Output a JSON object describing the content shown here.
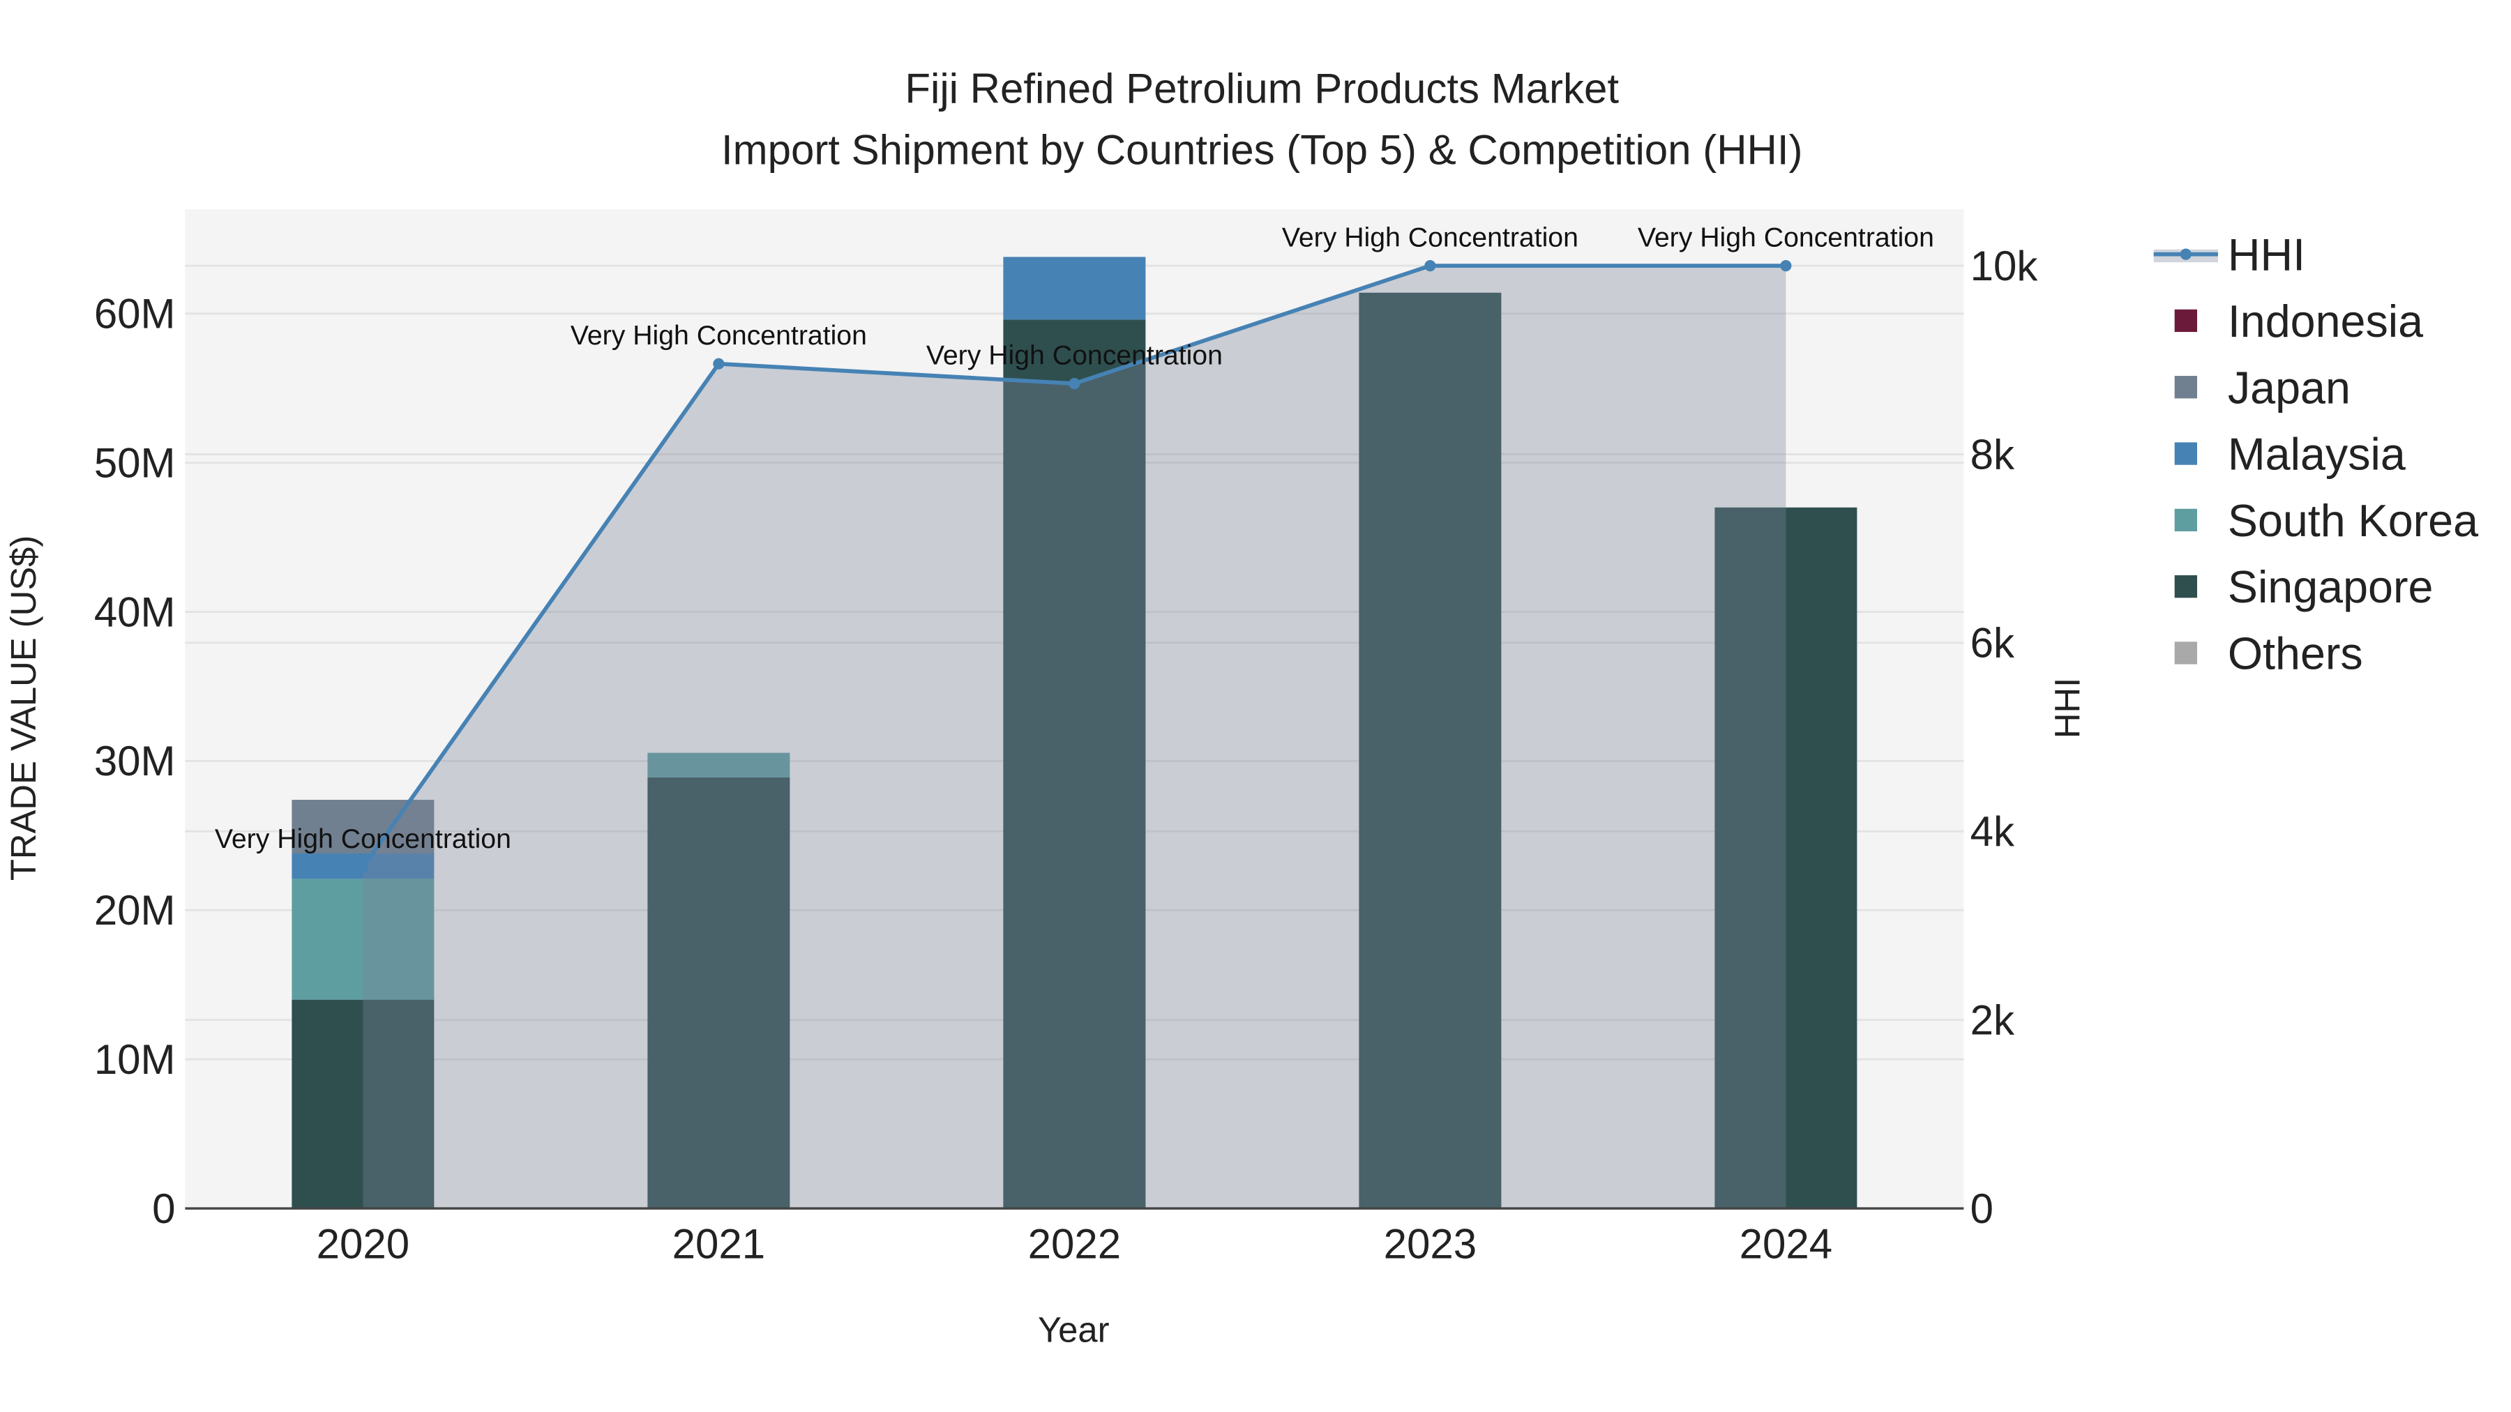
{
  "chart_data": {
    "type": "bar",
    "title": "Fiji Refined Petrolium Products Market",
    "subtitle": "Import Shipment by Countries (Top 5) & Competition (HHI)",
    "xlabel": "Year",
    "ylabel": "TRADE VALUE (US$)",
    "y2label": "HHI",
    "categories": [
      "2020",
      "2021",
      "2022",
      "2023",
      "2024"
    ],
    "ylim": [
      0,
      67000000
    ],
    "y2lim": [
      0,
      10600
    ],
    "yticks": [
      {
        "v": 0,
        "label": "0"
      },
      {
        "v": 10000000,
        "label": "10M"
      },
      {
        "v": 20000000,
        "label": "20M"
      },
      {
        "v": 30000000,
        "label": "30M"
      },
      {
        "v": 40000000,
        "label": "40M"
      },
      {
        "v": 50000000,
        "label": "50M"
      },
      {
        "v": 60000000,
        "label": "60M"
      }
    ],
    "y2ticks": [
      {
        "v": 0,
        "label": "0"
      },
      {
        "v": 2000,
        "label": "2k"
      },
      {
        "v": 4000,
        "label": "4k"
      },
      {
        "v": 6000,
        "label": "6k"
      },
      {
        "v": 8000,
        "label": "8k"
      },
      {
        "v": 10000,
        "label": "10k"
      }
    ],
    "series": [
      {
        "name": "Singapore",
        "color": "#2f4f4f",
        "values": [
          14000000,
          28900000,
          59600000,
          61400000,
          47000000
        ]
      },
      {
        "name": "South Korea",
        "color": "#5f9ea0",
        "values": [
          8100000,
          1650000,
          0,
          0,
          0
        ]
      },
      {
        "name": "Malaysia",
        "color": "#4682b4",
        "values": [
          1700000,
          0,
          4200000,
          0,
          0
        ]
      },
      {
        "name": "Japan",
        "color": "#708090",
        "values": [
          3600000,
          0,
          0,
          0,
          0
        ]
      },
      {
        "name": "Indonesia",
        "color": "#6b1a3a",
        "values": [
          0,
          0,
          0,
          0,
          0
        ]
      },
      {
        "name": "Others",
        "color": "#a9a9a9",
        "values": [
          0,
          0,
          0,
          0,
          0
        ]
      }
    ],
    "hhi": {
      "name": "HHI",
      "color": "#4682b4",
      "values": [
        3620,
        8960,
        8750,
        10000,
        10000
      ],
      "annotations": [
        "Very High Concentration",
        "Very High Concentration",
        "Very High Concentration",
        "Very High Concentration",
        "Very High Concentration"
      ]
    },
    "legend": {
      "placement": "right",
      "entries": [
        "HHI",
        "Indonesia",
        "Japan",
        "Malaysia",
        "South Korea",
        "Singapore",
        "Others"
      ]
    },
    "grid": true
  }
}
